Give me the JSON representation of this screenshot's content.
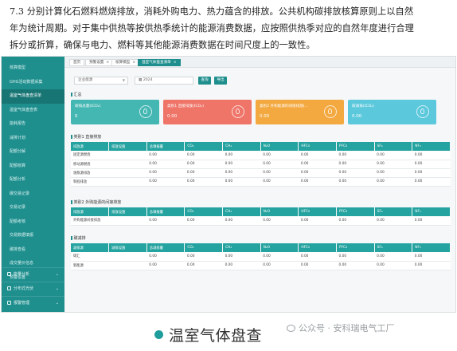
{
  "doc": {
    "line1": "7.3   分别计算化石燃料燃烧排放，消耗外购电力、热力蕴含的排放。公共机构碳排放核算原则上以自然",
    "line2": "年为统计周期。对于集中供热等按供热季统计的能源消费数据，应按照供热季对应的自然年度进行合理",
    "line3": "拆分或折算，确保与电力、燃料等其他能源消费数据在时间尺度上的一致性。"
  },
  "sidebar": {
    "items": [
      {
        "label": "核算模型"
      },
      {
        "label": "GHG活动数据采集"
      },
      {
        "label": "温室气体盘查清单"
      },
      {
        "label": "温室气体盘查表"
      },
      {
        "label": "能耗报告"
      },
      {
        "label": "减排计划"
      },
      {
        "label": "配额分解"
      },
      {
        "label": "配额核算"
      },
      {
        "label": "配额分析"
      },
      {
        "label": "碳交易记录"
      },
      {
        "label": "交易记录"
      },
      {
        "label": "配额考核"
      },
      {
        "label": "交易数据填报"
      },
      {
        "label": "碳排查看"
      },
      {
        "label": "成交量价信息"
      },
      {
        "label": "预警设置"
      }
    ],
    "groups": [
      {
        "label": "能量分析"
      },
      {
        "label": "分布式光伏"
      },
      {
        "label": "报警管理"
      }
    ]
  },
  "tabs": [
    {
      "label": "首页"
    },
    {
      "label": "预警设置"
    },
    {
      "label": "核算模型"
    },
    {
      "label": "温室气体盘查清单"
    }
  ],
  "filter": {
    "org_value": "企业能源",
    "year_value": "2024",
    "search_label": "查询",
    "export_label": "导出"
  },
  "summary": {
    "title": "汇总",
    "cards": [
      {
        "label": "碳排总量(tCO₂)",
        "value": "0",
        "color": "#45b7b3",
        "icon": "leaf-icon"
      },
      {
        "label": "类别1 直接排放(tCO₂)",
        "value": "0.00",
        "color": "#ef7569",
        "icon": "fire-icon"
      },
      {
        "label": "类别2 外购能源的间接排放(...",
        "value": "0.00",
        "color": "#f3a940",
        "icon": "cloud-icon"
      },
      {
        "label": "碳减排(tCO₂)",
        "value": "0.00",
        "color": "#5cc8dc",
        "icon": "recycle-icon"
      }
    ]
  },
  "cat1": {
    "title": "类别1 直接排放",
    "headers": [
      "排放源",
      "排放设施",
      "总填报量",
      "CO₂",
      "CH₄",
      "N₂O",
      "HFCs",
      "PFCs",
      "SF₆",
      "NF₃"
    ],
    "rows": [
      [
        "固定源燃烧",
        "",
        "0.00",
        "0.00",
        "0.00",
        "0.00",
        "0.00",
        "0.00",
        "0.00",
        "0.00"
      ],
      [
        "移动源燃烧",
        "",
        "0.00",
        "0.00",
        "0.00",
        "0.00",
        "0.00",
        "0.00",
        "0.00",
        "0.00"
      ],
      [
        "逸散源排放",
        "",
        "0.00",
        "0.00",
        "0.00",
        "0.00",
        "0.00",
        "0.00",
        "0.00",
        "0.00"
      ],
      [
        "制程排放",
        "",
        "0.00",
        "0.00",
        "0.00",
        "0.00",
        "0.00",
        "0.00",
        "0.00",
        "0.00"
      ]
    ]
  },
  "cat2": {
    "title": "类别2 外购能源的间接排放",
    "headers": [
      "排放源",
      "排放设施",
      "总填报量",
      "CO₂",
      "CH₄",
      "N₂O",
      "HFCs",
      "PFCs",
      "SF₆",
      "NF₃"
    ],
    "rows": [
      [
        "外购能源间接排放",
        "",
        "0.00",
        "0.00",
        "0.00",
        "0.00",
        "0.00",
        "0.00",
        "0.00",
        "0.00"
      ]
    ]
  },
  "reduction": {
    "title": "碳减排",
    "headers": [
      "减排源",
      "减排设施",
      "总减排量",
      "CO₂",
      "CH₄",
      "N₂O",
      "HFCs",
      "PFCs",
      "SF₆",
      "NF₃"
    ],
    "rows": [
      [
        "碳汇",
        "",
        "0.00",
        "0.00",
        "0.00",
        "0.00",
        "0.00",
        "0.00",
        "0.00",
        "0.00"
      ],
      [
        "新能源",
        "",
        "0.00",
        "0.00",
        "0.00",
        "0.00",
        "0.00",
        "0.00",
        "0.00",
        "0.00"
      ]
    ]
  },
  "caption": "温室气体盘查",
  "watermark": "公众号 · 安科瑞电气工厂"
}
